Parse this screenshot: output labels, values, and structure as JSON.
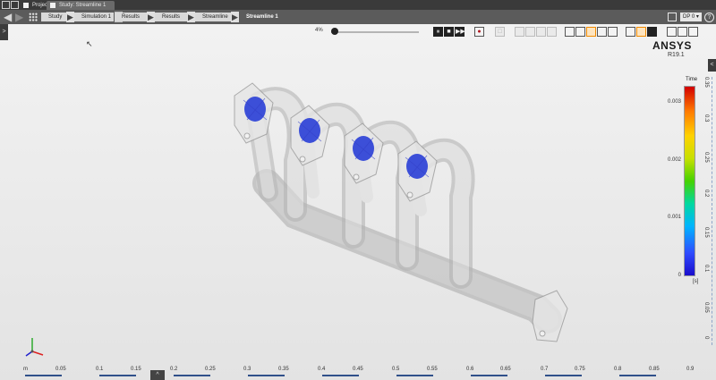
{
  "window": {
    "tab_project": "Project",
    "tab_active": "Study: Streamline 1"
  },
  "breadcrumb": {
    "items": [
      "Study",
      "Simulation 1",
      "Results",
      "Results",
      "Streamline",
      "Streamline 1"
    ],
    "dp_label": "DP 0 ▾",
    "help": "?"
  },
  "playback": {
    "progress_label": "4%",
    "progress": 0.04
  },
  "brand": {
    "name": "ANSYS",
    "version": "R19.1"
  },
  "legend": {
    "title": "Time",
    "ticks": [
      "0.003",
      "0.002",
      "0.001",
      "0"
    ],
    "unit": "[s]",
    "colors": [
      "#d20000",
      "#ff7a00",
      "#ffd200",
      "#46d200",
      "#00b4ff",
      "#1a0dcc"
    ]
  },
  "vertical_scale": {
    "labels": [
      "0.35",
      "0.3",
      "0.25",
      "0.2",
      "0.15",
      "0.1",
      "0.05",
      "0"
    ]
  },
  "horizontal_scale": {
    "unit": "m",
    "labels": [
      "0.05",
      "0.1",
      "0.15",
      "0.2",
      "0.25",
      "0.3",
      "0.35",
      "0.4",
      "0.45",
      "0.5",
      "0.55",
      "0.6",
      "0.65",
      "0.7",
      "0.75",
      "0.8",
      "0.85",
      "0.9"
    ]
  },
  "panel_toggles": {
    "left": ">",
    "right": "<",
    "bottom": "^"
  },
  "icons": {
    "play": "⏸",
    "stop": "■",
    "step": "▶▶",
    "record": "●",
    "toolbar_glyph": "□",
    "cursor": "↖",
    "back": "◀",
    "forward": "▶",
    "crumb_sep": "▶"
  },
  "colors": {
    "accent": "#f08a00",
    "particles": "#1f35d6",
    "pipe": "#bdbdbd"
  }
}
